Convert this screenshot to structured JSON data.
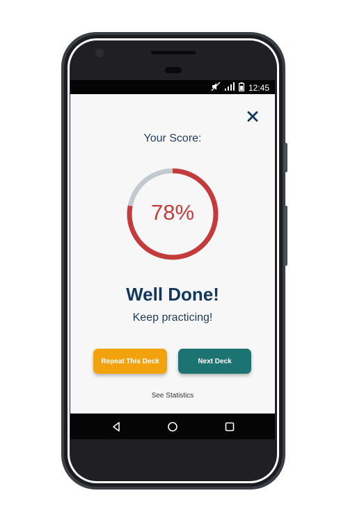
{
  "status_bar": {
    "time": "12:45",
    "icons": [
      "mute-icon",
      "signal-icon",
      "battery-icon"
    ]
  },
  "result_screen": {
    "score_label": "Your Score:",
    "score_percent": "78%",
    "score_value": 78,
    "title": "Well Done!",
    "subtitle": "Keep practicing!",
    "repeat_button_label": "Repeat This Deck",
    "next_button_label": "Next Deck",
    "statistics_link": "See Statistics",
    "close_icon": "close-icon"
  },
  "nav_bar": {
    "icons": [
      "back-icon",
      "home-icon",
      "recent-apps-icon"
    ]
  },
  "colors": {
    "score_ring": "#c33b3b",
    "score_ring_track": "#c3c9cf",
    "repeat_button": "#f2a20c",
    "next_button": "#1d7272",
    "title_text": "#12385b"
  }
}
